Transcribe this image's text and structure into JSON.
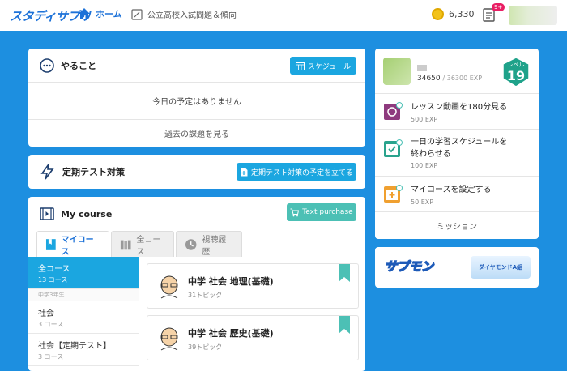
{
  "header": {
    "logo": "スタディサプリ",
    "home": "ホーム",
    "exam": "公立高校入試問題＆傾向",
    "coins": "6,330",
    "notif_badge": "9+"
  },
  "todo": {
    "title": "やること",
    "schedule_button": "スケジュール",
    "empty_text": "今日の予定はありません",
    "past_link": "過去の課題を見る"
  },
  "test_prep": {
    "title": "定期テスト対策",
    "button": "定期テスト対策の予定を立てる"
  },
  "my_course": {
    "title": "My course",
    "text_purchase": "Text purchase",
    "tabs": [
      {
        "label": "マイコース"
      },
      {
        "label": "全コース"
      },
      {
        "label": "視聴履歴"
      }
    ],
    "sidebar": [
      {
        "title": "全コース",
        "sub": "13 コース"
      },
      {
        "section": "中学3年生"
      },
      {
        "title": "社会",
        "sub": "3 コース"
      },
      {
        "title": "社会【定期テスト】",
        "sub": "3 コース"
      }
    ],
    "courses": [
      {
        "title": "中学 社会 地理(基礎)",
        "topics": "31トピック"
      },
      {
        "title": "中学 社会 歴史(基礎)",
        "topics": "39トピック"
      }
    ]
  },
  "profile": {
    "exp": "34650",
    "exp_total": "/ 36300 EXP",
    "level_label": "レベル",
    "level": "19"
  },
  "missions": {
    "items": [
      {
        "title": "レッスン動画を180分見る",
        "exp": "500 EXP",
        "color": "#8e3a7e"
      },
      {
        "title": "一日の学習スケジュールを終わらせる",
        "exp": "100 EXP",
        "color": "#2aa38d"
      },
      {
        "title": "マイコースを設定する",
        "exp": "50 EXP",
        "color": "#f0a030"
      }
    ],
    "link": "ミッション"
  },
  "banner": {
    "left": "サプモン",
    "right": "ダイヤモンドA組"
  },
  "colors": {
    "primary": "#1d8fe0",
    "accent": "#1ba6e0",
    "teal": "#4cc0b5"
  }
}
